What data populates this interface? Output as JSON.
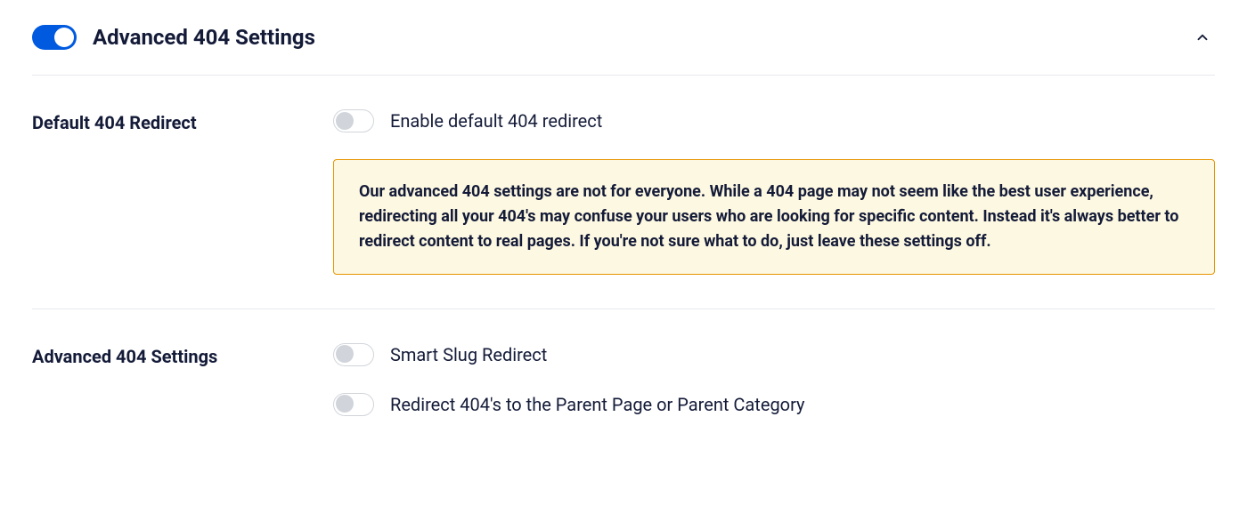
{
  "header": {
    "title": "Advanced 404 Settings",
    "main_toggle_on": true
  },
  "sections": {
    "default_redirect": {
      "label": "Default 404 Redirect",
      "toggle_label": "Enable default 404 redirect",
      "warning": "Our advanced 404 settings are not for everyone. While a 404 page may not seem like the best user experience, redirecting all your 404's may confuse your users who are looking for specific content. Instead it's always better to redirect content to real pages. If you're not sure what to do, just leave these settings off."
    },
    "advanced": {
      "label": "Advanced 404 Settings",
      "smart_slug_label": "Smart Slug Redirect",
      "parent_redirect_label": "Redirect 404's to the Parent Page or Parent Category"
    }
  }
}
